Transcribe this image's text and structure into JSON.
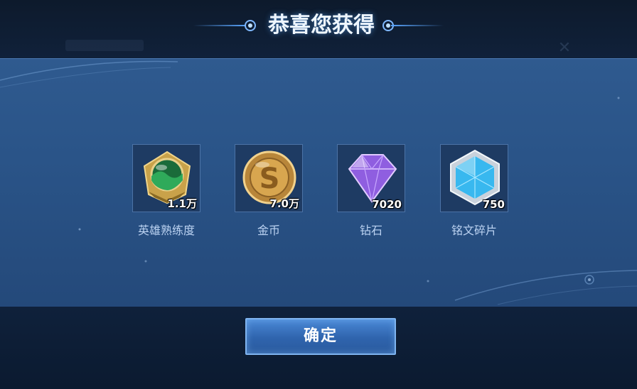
{
  "dialog": {
    "title": "恭喜您获得",
    "confirm_label": "确定"
  },
  "rewards": [
    {
      "name": "英雄熟练度",
      "count": "1.1万",
      "icon": "hero-proficiency-emblem-icon"
    },
    {
      "name": "金币",
      "count": "7.0万",
      "icon": "gold-coin-icon"
    },
    {
      "name": "钻石",
      "count": "7020",
      "icon": "diamond-icon"
    },
    {
      "name": "铭文碎片",
      "count": "750",
      "icon": "inscription-fragment-icon"
    }
  ],
  "colors": {
    "panel": "#2a5488",
    "background": "#0b1a30",
    "title_glow": "#5aa6ff",
    "button": "#2f64ad"
  }
}
